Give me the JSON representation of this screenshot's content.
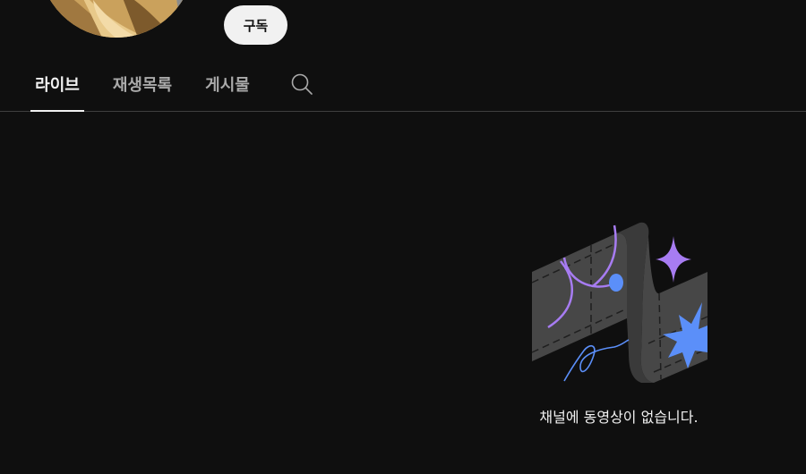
{
  "channel": {
    "subscribe_label": "구독"
  },
  "tabs": [
    {
      "label": "라이브",
      "active": true
    },
    {
      "label": "재생목록",
      "active": false
    },
    {
      "label": "게시물",
      "active": false
    }
  ],
  "icons": {
    "search": "search-icon",
    "avatar": "avatar"
  },
  "empty_state": {
    "message": "채널에 동영상이 없습니다."
  },
  "colors": {
    "background": "#0f0f0f",
    "text_primary": "#f1f1f1",
    "text_secondary": "#aaaaaa",
    "divider": "#3f3f3f",
    "illustration_purple": "#a77cf2",
    "illustration_blue": "#5b8ff9"
  }
}
